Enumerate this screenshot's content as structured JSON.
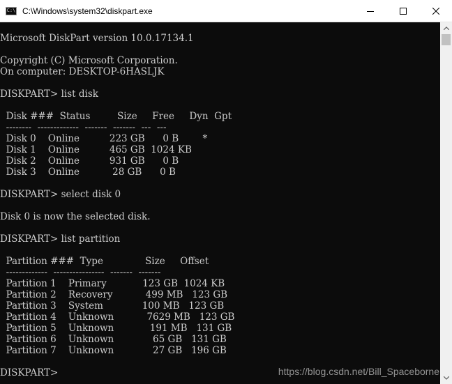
{
  "window": {
    "title": "C:\\Windows\\system32\\diskpart.exe",
    "icon": "console-icon",
    "icon_glyph": "C:\\"
  },
  "controls": {
    "minimize_icon": "minimize-icon",
    "maximize_icon": "maximize-icon",
    "close_icon": "close-icon"
  },
  "console": {
    "lines": [
      "Microsoft DiskPart version 10.0.17134.1",
      "",
      "Copyright (C) Microsoft Corporation.",
      "On computer: DESKTOP-6HASLJK",
      "",
      "DISKPART> list disk",
      "",
      "  Disk ###  Status         Size     Free     Dyn  Gpt",
      "  --------  -------------  -------  -------  ---  ---",
      "  Disk 0    Online          223 GB      0 B        *",
      "  Disk 1    Online          465 GB  1024 KB",
      "  Disk 2    Online          931 GB      0 B",
      "  Disk 3    Online           28 GB      0 B",
      "",
      "DISKPART> select disk 0",
      "",
      "Disk 0 is now the selected disk.",
      "",
      "DISKPART> list partition",
      "",
      "  Partition ###  Type              Size     Offset",
      "  -------------  ----------------  -------  -------",
      "  Partition 1    Primary            123 GB  1024 KB",
      "  Partition 2    Recovery           499 MB   123 GB",
      "  Partition 3    System             100 MB   123 GB",
      "  Partition 4    Unknown           7629 MB   123 GB",
      "  Partition 5    Unknown            191 MB   131 GB",
      "  Partition 6    Unknown             65 GB   131 GB",
      "  Partition 7    Unknown             27 GB   196 GB",
      "",
      "DISKPART> "
    ],
    "background": "#0c0c0c",
    "foreground": "#cccccc"
  },
  "watermark": "https://blog.csdn.net/Bill_Spaceborne"
}
